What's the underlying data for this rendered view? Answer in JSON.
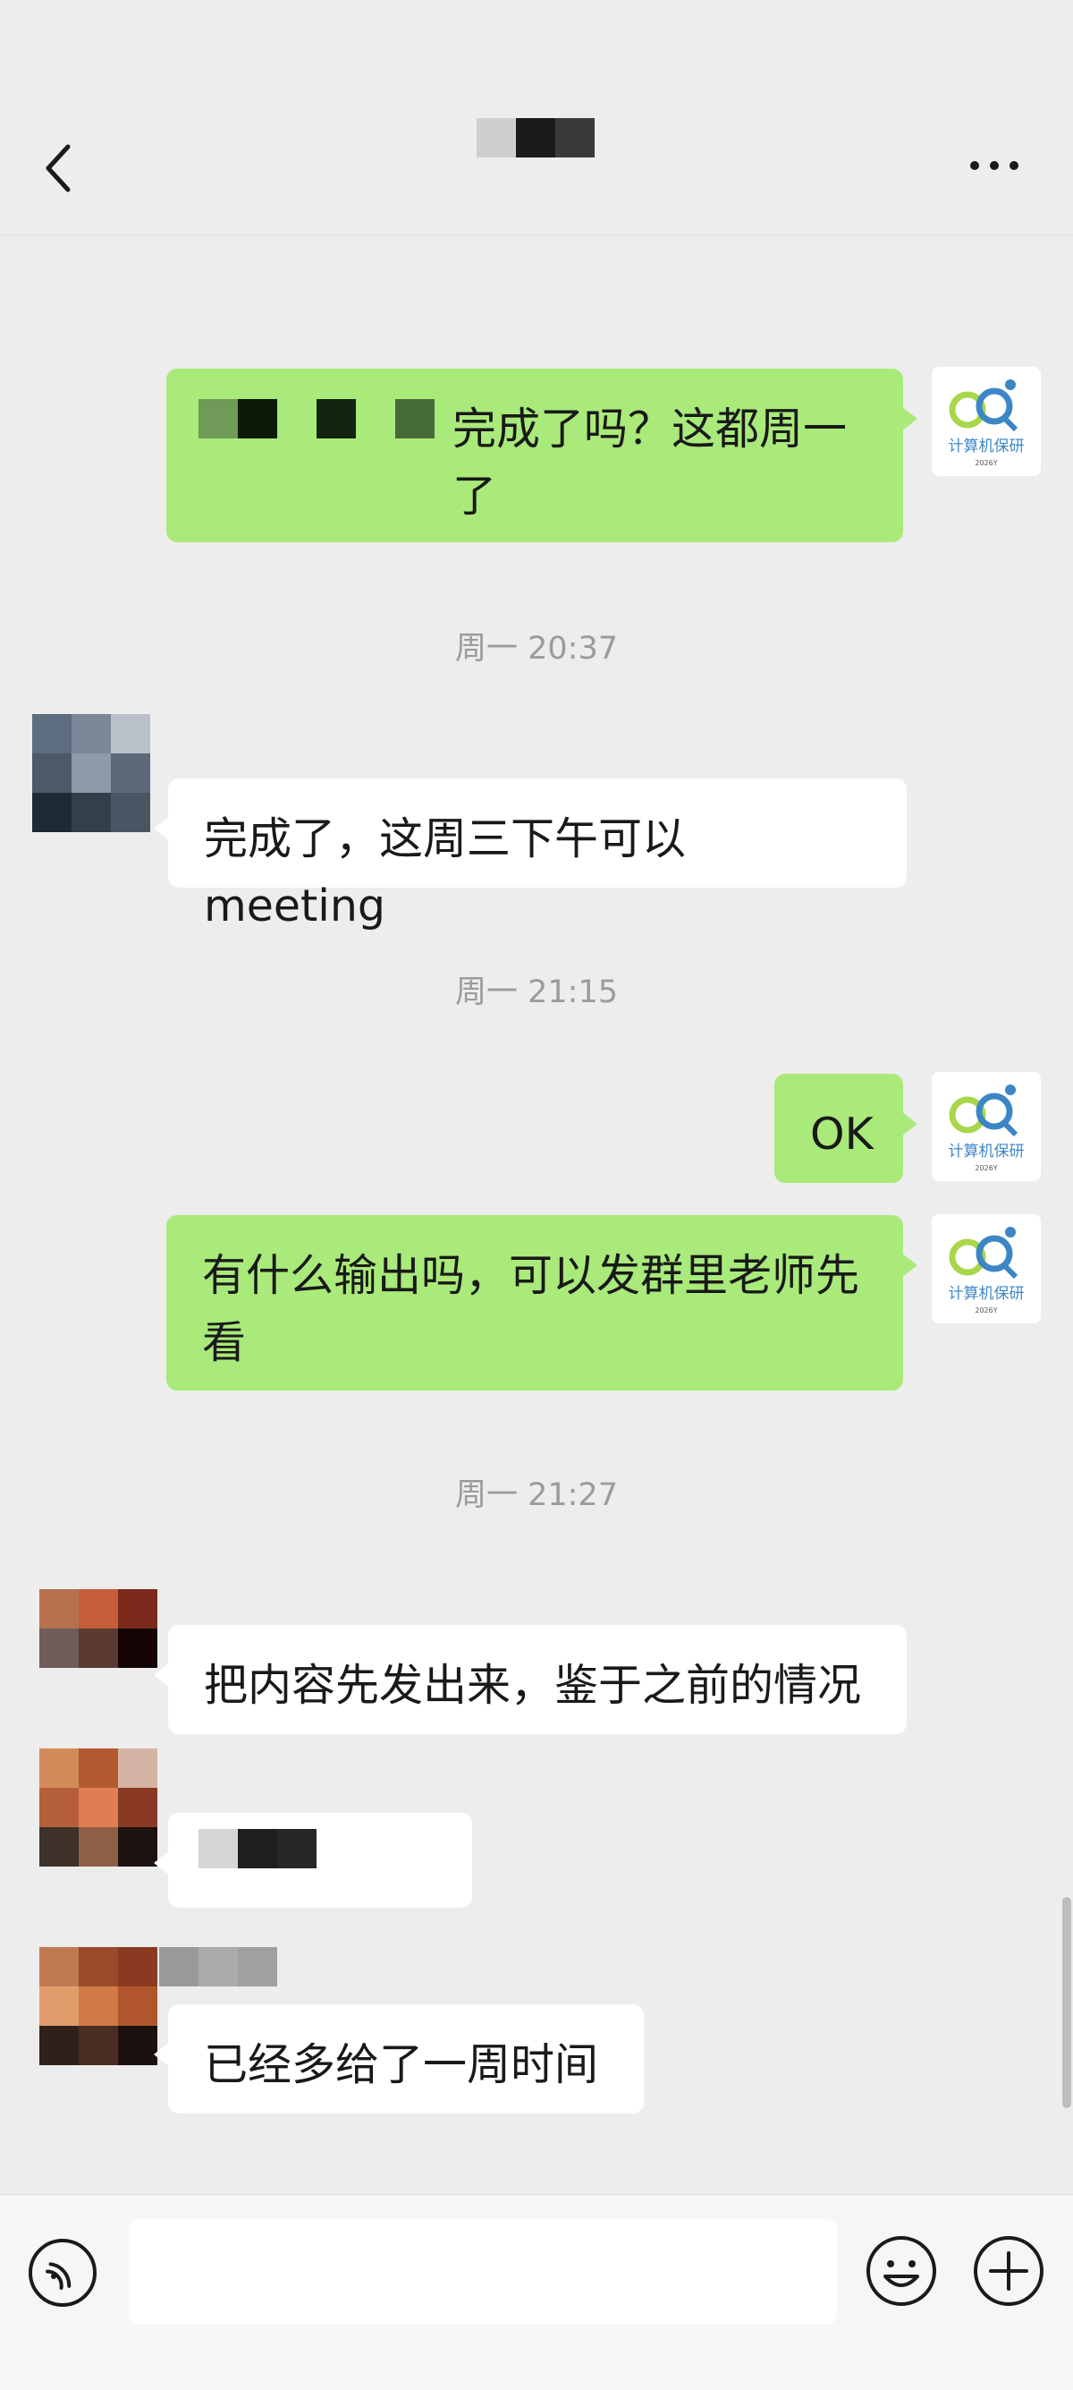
{
  "header": {
    "back_icon": "chevron-left-icon",
    "more_icon": "more-icon",
    "title_mosaic_colors": [
      "#cfcfcf",
      "#1b1b1b",
      "#3a3a3a"
    ]
  },
  "messages": [
    {
      "sender": "me",
      "text": "完成了吗？这都周一了"
    },
    {
      "type": "timestamp",
      "text": "周一 20:37"
    },
    {
      "sender": "them",
      "text": "完成了，这周三下午可以 meeting"
    },
    {
      "type": "timestamp",
      "text": "周一 21:15"
    },
    {
      "sender": "me",
      "text": "OK"
    },
    {
      "sender": "me",
      "text": "有什么输出吗，可以发群里老师先看"
    },
    {
      "type": "timestamp",
      "text": "周一 21:27"
    },
    {
      "sender": "them",
      "text": "把内容先发出来，鉴于之前的情况"
    },
    {
      "sender": "them",
      "text": ""
    },
    {
      "sender": "them",
      "text": "已经多给了一周时间"
    }
  ],
  "avatar_me": {
    "logo_text": "计算机保研",
    "logo_small": "2026Y"
  },
  "input_bar": {
    "voice_icon": "voice-icon",
    "emoji_icon": "emoji-icon",
    "plus_icon": "plus-icon",
    "input_value": ""
  },
  "colors": {
    "my_bubble": "#a9ea7a",
    "their_bubble": "#ffffff",
    "background": "#ededed"
  }
}
